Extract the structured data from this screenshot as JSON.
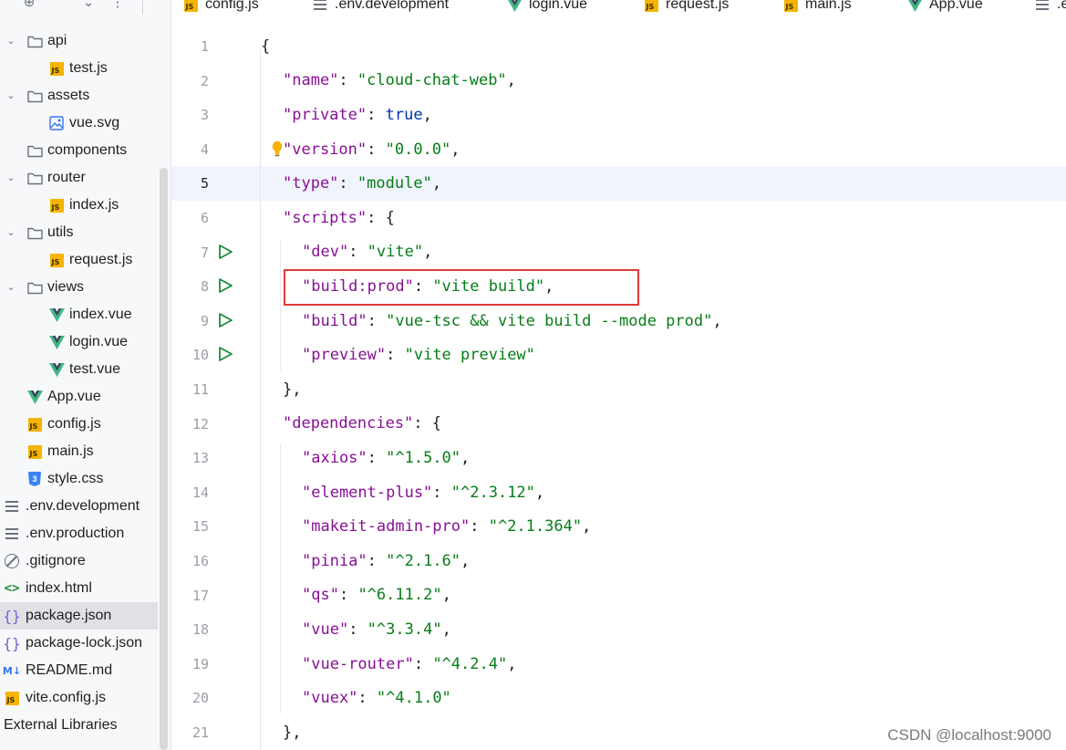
{
  "sidebar": {
    "toolbar_icons": [
      "target-icon",
      "expand-icon",
      "collapse-icon",
      "more-icon"
    ],
    "items": [
      {
        "label": "api",
        "type": "folder",
        "depth": 1,
        "expanded": true
      },
      {
        "label": "test.js",
        "type": "js",
        "depth": 2
      },
      {
        "label": "assets",
        "type": "folder",
        "depth": 1,
        "expanded": true
      },
      {
        "label": "vue.svg",
        "type": "image",
        "depth": 2
      },
      {
        "label": "components",
        "type": "folder",
        "depth": 1,
        "expanded": false
      },
      {
        "label": "router",
        "type": "folder",
        "depth": 1,
        "expanded": true
      },
      {
        "label": "index.js",
        "type": "js",
        "depth": 2
      },
      {
        "label": "utils",
        "type": "folder",
        "depth": 1,
        "expanded": true
      },
      {
        "label": "request.js",
        "type": "js",
        "depth": 2
      },
      {
        "label": "views",
        "type": "folder",
        "depth": 1,
        "expanded": true
      },
      {
        "label": "index.vue",
        "type": "vue",
        "depth": 2
      },
      {
        "label": "login.vue",
        "type": "vue",
        "depth": 2
      },
      {
        "label": "test.vue",
        "type": "vue",
        "depth": 2
      },
      {
        "label": "App.vue",
        "type": "vue",
        "depth": 1
      },
      {
        "label": "config.js",
        "type": "js",
        "depth": 1
      },
      {
        "label": "main.js",
        "type": "js",
        "depth": 1
      },
      {
        "label": "style.css",
        "type": "css",
        "depth": 1
      },
      {
        "label": ".env.development",
        "type": "text",
        "depth": 0
      },
      {
        "label": ".env.production",
        "type": "text",
        "depth": 0
      },
      {
        "label": ".gitignore",
        "type": "ignore",
        "depth": 0
      },
      {
        "label": "index.html",
        "type": "html",
        "depth": 0
      },
      {
        "label": "package.json",
        "type": "json",
        "depth": 0,
        "selected": true
      },
      {
        "label": "package-lock.json",
        "type": "json",
        "depth": 0
      },
      {
        "label": "README.md",
        "type": "md",
        "depth": 0
      },
      {
        "label": "vite.config.js",
        "type": "js",
        "depth": 0
      },
      {
        "label": "External Libraries",
        "type": "none",
        "depth": -1
      }
    ]
  },
  "tabs": [
    {
      "label": "config.js",
      "type": "js"
    },
    {
      "label": ".env.development",
      "type": "text"
    },
    {
      "label": "login.vue",
      "type": "vue"
    },
    {
      "label": "request.js",
      "type": "js"
    },
    {
      "label": "main.js",
      "type": "js"
    },
    {
      "label": "App.vue",
      "type": "vue"
    },
    {
      "label": ".e",
      "type": "text"
    }
  ],
  "editor": {
    "active_line": 5,
    "highlighted_box_line": 8,
    "lines": [
      {
        "n": "1",
        "tokens": [
          [
            "punc",
            "{"
          ]
        ],
        "indent": 0
      },
      {
        "n": "2",
        "tokens": [
          [
            "key",
            "\"name\""
          ],
          [
            "punc",
            ": "
          ],
          [
            "str",
            "\"cloud-chat-web\""
          ],
          [
            "punc",
            ","
          ]
        ],
        "indent": 1
      },
      {
        "n": "3",
        "tokens": [
          [
            "key",
            "\"private\""
          ],
          [
            "punc",
            ": "
          ],
          [
            "kw",
            "true"
          ],
          [
            "punc",
            ","
          ]
        ],
        "indent": 1
      },
      {
        "n": "4",
        "tokens": [
          [
            "key",
            "\"version\""
          ],
          [
            "punc",
            ": "
          ],
          [
            "str",
            "\"0.0.0\""
          ],
          [
            "punc",
            ","
          ]
        ],
        "indent": 1
      },
      {
        "n": "5",
        "tokens": [
          [
            "key",
            "\"type\""
          ],
          [
            "punc",
            ": "
          ],
          [
            "str",
            "\"module\""
          ],
          [
            "punc",
            ","
          ]
        ],
        "indent": 1
      },
      {
        "n": "6",
        "tokens": [
          [
            "key",
            "\"scripts\""
          ],
          [
            "punc",
            ": {"
          ]
        ],
        "indent": 1
      },
      {
        "n": "7",
        "tokens": [
          [
            "key",
            "\"dev\""
          ],
          [
            "punc",
            ": "
          ],
          [
            "str",
            "\"vite\""
          ],
          [
            "punc",
            ","
          ]
        ],
        "indent": 2,
        "run": true
      },
      {
        "n": "8",
        "tokens": [
          [
            "key",
            "\"build:prod\""
          ],
          [
            "punc",
            ": "
          ],
          [
            "str",
            "\"vite build\""
          ],
          [
            "punc",
            ","
          ]
        ],
        "indent": 2,
        "run": true
      },
      {
        "n": "9",
        "tokens": [
          [
            "key",
            "\"build\""
          ],
          [
            "punc",
            ": "
          ],
          [
            "str",
            "\"vue-tsc && vite build --mode prod\""
          ],
          [
            "punc",
            ","
          ]
        ],
        "indent": 2,
        "run": true
      },
      {
        "n": "10",
        "tokens": [
          [
            "key",
            "\"preview\""
          ],
          [
            "punc",
            ": "
          ],
          [
            "str",
            "\"vite preview\""
          ]
        ],
        "indent": 2,
        "run": true
      },
      {
        "n": "11",
        "tokens": [
          [
            "punc",
            "},"
          ]
        ],
        "indent": 1
      },
      {
        "n": "12",
        "tokens": [
          [
            "key",
            "\"dependencies\""
          ],
          [
            "punc",
            ": {"
          ]
        ],
        "indent": 1
      },
      {
        "n": "13",
        "tokens": [
          [
            "key",
            "\"axios\""
          ],
          [
            "punc",
            ": "
          ],
          [
            "str",
            "\"^1.5.0\""
          ],
          [
            "punc",
            ","
          ]
        ],
        "indent": 2
      },
      {
        "n": "14",
        "tokens": [
          [
            "key",
            "\"element-plus\""
          ],
          [
            "punc",
            ": "
          ],
          [
            "str",
            "\"^2.3.12\""
          ],
          [
            "punc",
            ","
          ]
        ],
        "indent": 2
      },
      {
        "n": "15",
        "tokens": [
          [
            "key",
            "\"makeit-admin-pro\""
          ],
          [
            "punc",
            ": "
          ],
          [
            "str",
            "\"^2.1.364\""
          ],
          [
            "punc",
            ","
          ]
        ],
        "indent": 2
      },
      {
        "n": "16",
        "tokens": [
          [
            "key",
            "\"pinia\""
          ],
          [
            "punc",
            ": "
          ],
          [
            "str",
            "\"^2.1.6\""
          ],
          [
            "punc",
            ","
          ]
        ],
        "indent": 2
      },
      {
        "n": "17",
        "tokens": [
          [
            "key",
            "\"qs\""
          ],
          [
            "punc",
            ": "
          ],
          [
            "str",
            "\"^6.11.2\""
          ],
          [
            "punc",
            ","
          ]
        ],
        "indent": 2
      },
      {
        "n": "18",
        "tokens": [
          [
            "key",
            "\"vue\""
          ],
          [
            "punc",
            ": "
          ],
          [
            "str",
            "\"^3.3.4\""
          ],
          [
            "punc",
            ","
          ]
        ],
        "indent": 2
      },
      {
        "n": "19",
        "tokens": [
          [
            "key",
            "\"vue-router\""
          ],
          [
            "punc",
            ": "
          ],
          [
            "str",
            "\"^4.2.4\""
          ],
          [
            "punc",
            ","
          ]
        ],
        "indent": 2
      },
      {
        "n": "20",
        "tokens": [
          [
            "key",
            "\"vuex\""
          ],
          [
            "punc",
            ": "
          ],
          [
            "str",
            "\"^4.1.0\""
          ]
        ],
        "indent": 2
      },
      {
        "n": "21",
        "tokens": [
          [
            "punc",
            "},"
          ]
        ],
        "indent": 1
      }
    ]
  },
  "watermark": "CSDN @localhost:9000",
  "colors": {
    "key": "#871094",
    "string": "#067d17",
    "keyword": "#0033b3",
    "highlight_box": "#e03a3a",
    "active_line_bg": "#f0f4fc"
  }
}
